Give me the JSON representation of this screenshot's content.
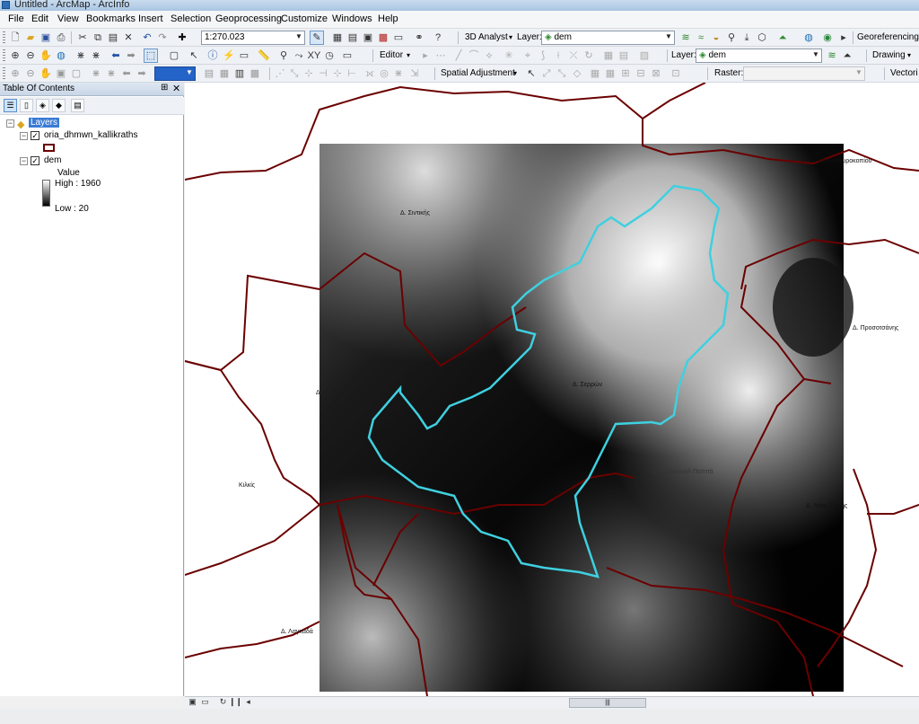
{
  "window": {
    "title": "Untitled - ArcMap - ArcInfo"
  },
  "menu": [
    "File",
    "Edit",
    "View",
    "Bookmarks",
    "Insert",
    "Selection",
    "Geoprocessing",
    "Customize",
    "Windows",
    "Help"
  ],
  "toolbar": {
    "scale_value": "1:270.023",
    "analyst_3d_label": "3D Analyst",
    "layer_label": "Layer:",
    "layer_value": "dem",
    "georeferencing_label": "Georeferencing",
    "editor_label": "Editor",
    "layer2_label": "Layer:",
    "layer2_value": "dem",
    "drawing_label": "Drawing",
    "spatial_adjustment_label": "Spatial Adjustment",
    "raster_label": "Raster:",
    "raster_value": "",
    "vector_label": "Vectori"
  },
  "toc": {
    "title": "Table Of Contents",
    "pin_glyph": "⊞",
    "close_glyph": "✕",
    "layers_root": "Layers",
    "layer1_name": "oria_dhmwn_kallikraths",
    "layer2_name": "dem",
    "legend_value_label": "Value",
    "legend_high": "High : 1960",
    "legend_low": "Low : 20",
    "legend_high_color": "#ffffff",
    "legend_low_color": "#000000",
    "boundary_color": "#6b0000"
  },
  "map": {
    "places": [
      "Δ. Κάτω Νευροκοπίου",
      "Δ. Σιντικής",
      "Δ. Προσοτσάνης",
      "Δ. Σερρών",
      "Δ. Νέας Ζίχνης",
      "Κιλκίς",
      "Δ. Λαγκαδά",
      "Δ. Εμμανουήλ Παππά",
      "Δ"
    ],
    "highlight_color": "#3fd0e0"
  },
  "statusbar": {
    "scroll_glyph": "|||"
  }
}
